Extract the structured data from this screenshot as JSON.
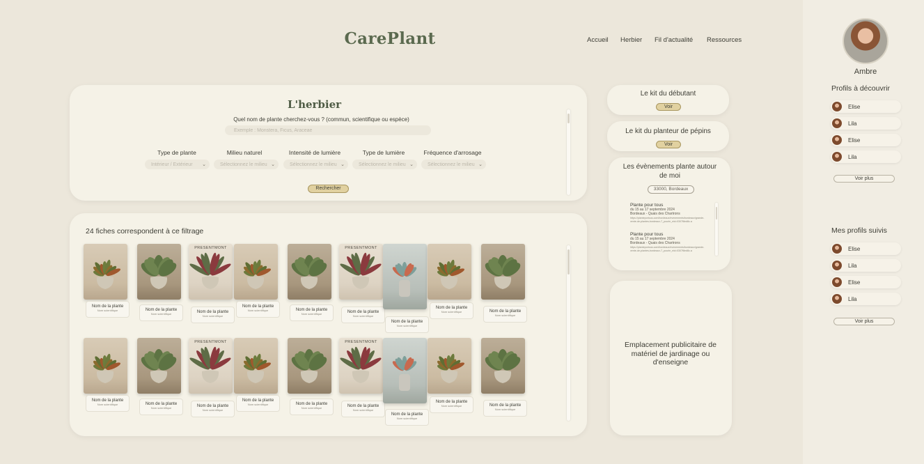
{
  "header": {
    "logo": "CarePlant",
    "nav": [
      "Accueil",
      "Herbier",
      "Fil d'actualité",
      "Ressources"
    ]
  },
  "user": {
    "name": "Ambre"
  },
  "discover": {
    "title": "Profils à découvrir",
    "profiles": [
      "Elise",
      "Lila",
      "Elise",
      "Lila"
    ],
    "more": "Voir plus"
  },
  "followed": {
    "title": "Mes profils suivis",
    "profiles": [
      "Elise",
      "Lila",
      "Elise",
      "Lila"
    ],
    "more": "Voir plus"
  },
  "herbier": {
    "title": "L'herbier",
    "question": "Quel nom de plante cherchez-vous ? (commun, scientifique ou espèce)",
    "search_placeholder": "Exemple : Monstera, Ficus, Araceae",
    "filters": [
      {
        "label": "Type de plante",
        "value": "Intérieur / Extérieur"
      },
      {
        "label": "Milieu naturel",
        "value": "Sélectionnez le milieu"
      },
      {
        "label": "Intensité de lumière",
        "value": "Sélectionnez le milieu"
      },
      {
        "label": "Type de lumière",
        "value": "Sélectionnez le milieu"
      },
      {
        "label": "Fréquence d'arrosage",
        "value": "Sélectionnez le milieu"
      }
    ],
    "search_button": "Rechercher"
  },
  "results": {
    "count_text": "24 fiches correspondent à ce filtrage",
    "card_name": "Nom de la plante",
    "card_sci": "Nom scientifique",
    "present_label": "PRESENTMONT"
  },
  "kits": [
    {
      "title": "Le kit du débutant",
      "button": "Voir"
    },
    {
      "title": "Le kit du planteur de pépins",
      "button": "Voir"
    }
  ],
  "events": {
    "title": "Les évènements plante autour de moi",
    "location": "33000, Bordeaux",
    "items": [
      {
        "title": "Plante pour tous",
        "date": "du 15 au 17 septembre 2024",
        "place": "Bordeaux - Quais des Chartrons",
        "url": "https://planteportous.com/bordeaux/evenements/bordeaux/grande-vente-de-plantes-bordeaux-7_pourle_eid=0307f8ed8c.a"
      },
      {
        "title": "Plante pour tous",
        "date": "du 15 au 17 septembre 2024",
        "place": "Bordeaux - Quais des Chartrons",
        "url": "https://planteportous.com/bordeaux/evenements/bordeaux/grande-vente-de-plantes-bordeaux-7_pourle_eid=0307f8ed8c.a"
      }
    ]
  },
  "ad": {
    "text": "Emplacement publicitaire de matériel de jardinage ou d'enseigne"
  },
  "colors": {
    "background": "#ece7db",
    "card": "#f5f2e7",
    "accent": "#e1d1a0",
    "logo": "#5b6a4f"
  },
  "icons": {
    "select": "chevron-down-icon"
  }
}
